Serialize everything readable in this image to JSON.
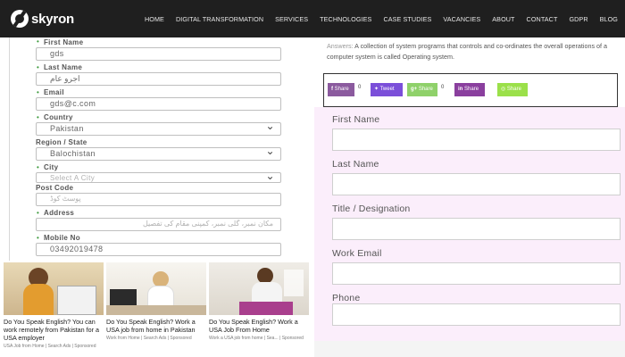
{
  "brand": {
    "name": "skyron"
  },
  "nav": {
    "items": [
      "HOME",
      "DIGITAL TRANSFORMATION",
      "SERVICES",
      "TECHNOLOGIES",
      "CASE STUDIES",
      "VACANCIES",
      "ABOUT",
      "CONTACT",
      "GDPR",
      "BLOG"
    ]
  },
  "left_form": {
    "first_name": {
      "label": "First Name",
      "value": "gds"
    },
    "last_name": {
      "label": "Last Name",
      "value": "اجرو عام"
    },
    "email": {
      "label": "Email",
      "value": "gds@c.com"
    },
    "country": {
      "label": "Country",
      "value": "Pakistan"
    },
    "region": {
      "label": "Region / State",
      "value": "Balochistan"
    },
    "city": {
      "label": "City",
      "placeholder": "Select A City"
    },
    "post_code": {
      "label": "Post Code",
      "value": "پوسٹ کوڈ"
    },
    "address": {
      "label": "Address",
      "value": "مکان نمبر، گلی نمبر، کمپنی مقام کی تفصیل"
    },
    "mobile": {
      "label": "Mobile No",
      "value": "03492019478"
    }
  },
  "ads": [
    {
      "title": "Do You Speak English? You can work remotely from Pakistan for a USA employer",
      "source": "USA Job from Home | Search Ads | Sponsored"
    },
    {
      "title": "Do You Speak English? Work a USA job from home in Pakistan",
      "source": "Work from Home | Search Ads | Sponsored"
    },
    {
      "title": "Do You Speak English? Work a USA Job From Home",
      "source": "Work a USA job from home | Sea... | Sponsored"
    }
  ],
  "answer": {
    "label": "Answers:",
    "text": "A collection of system programs that controls and co-ordinates the overall operations of a computer system is called Operating system."
  },
  "share": {
    "facebook": {
      "label": "Share",
      "count": "0",
      "color": "#8b5a9e",
      "icon": "facebook-icon"
    },
    "twitter": {
      "label": "Tweet",
      "color": "#7b4fd9",
      "icon": "twitter-icon"
    },
    "google": {
      "label": "Share",
      "count": "0",
      "color": "#8fd16a",
      "icon": "google-plus-icon"
    },
    "linkedin": {
      "label": "Share",
      "color": "#8a3f9e",
      "icon": "linkedin-icon"
    },
    "whatsapp": {
      "label": "Share",
      "color": "#9be04a",
      "icon": "whatsapp-icon"
    }
  },
  "right_form": {
    "labels": [
      "First Name",
      "Last Name",
      "Title / Designation",
      "Work Email",
      "Phone"
    ]
  },
  "colors": {
    "nav_bg": "#1f1f1f",
    "form_bg": "#fbeefb",
    "required_marker": "#3c9a3c"
  }
}
